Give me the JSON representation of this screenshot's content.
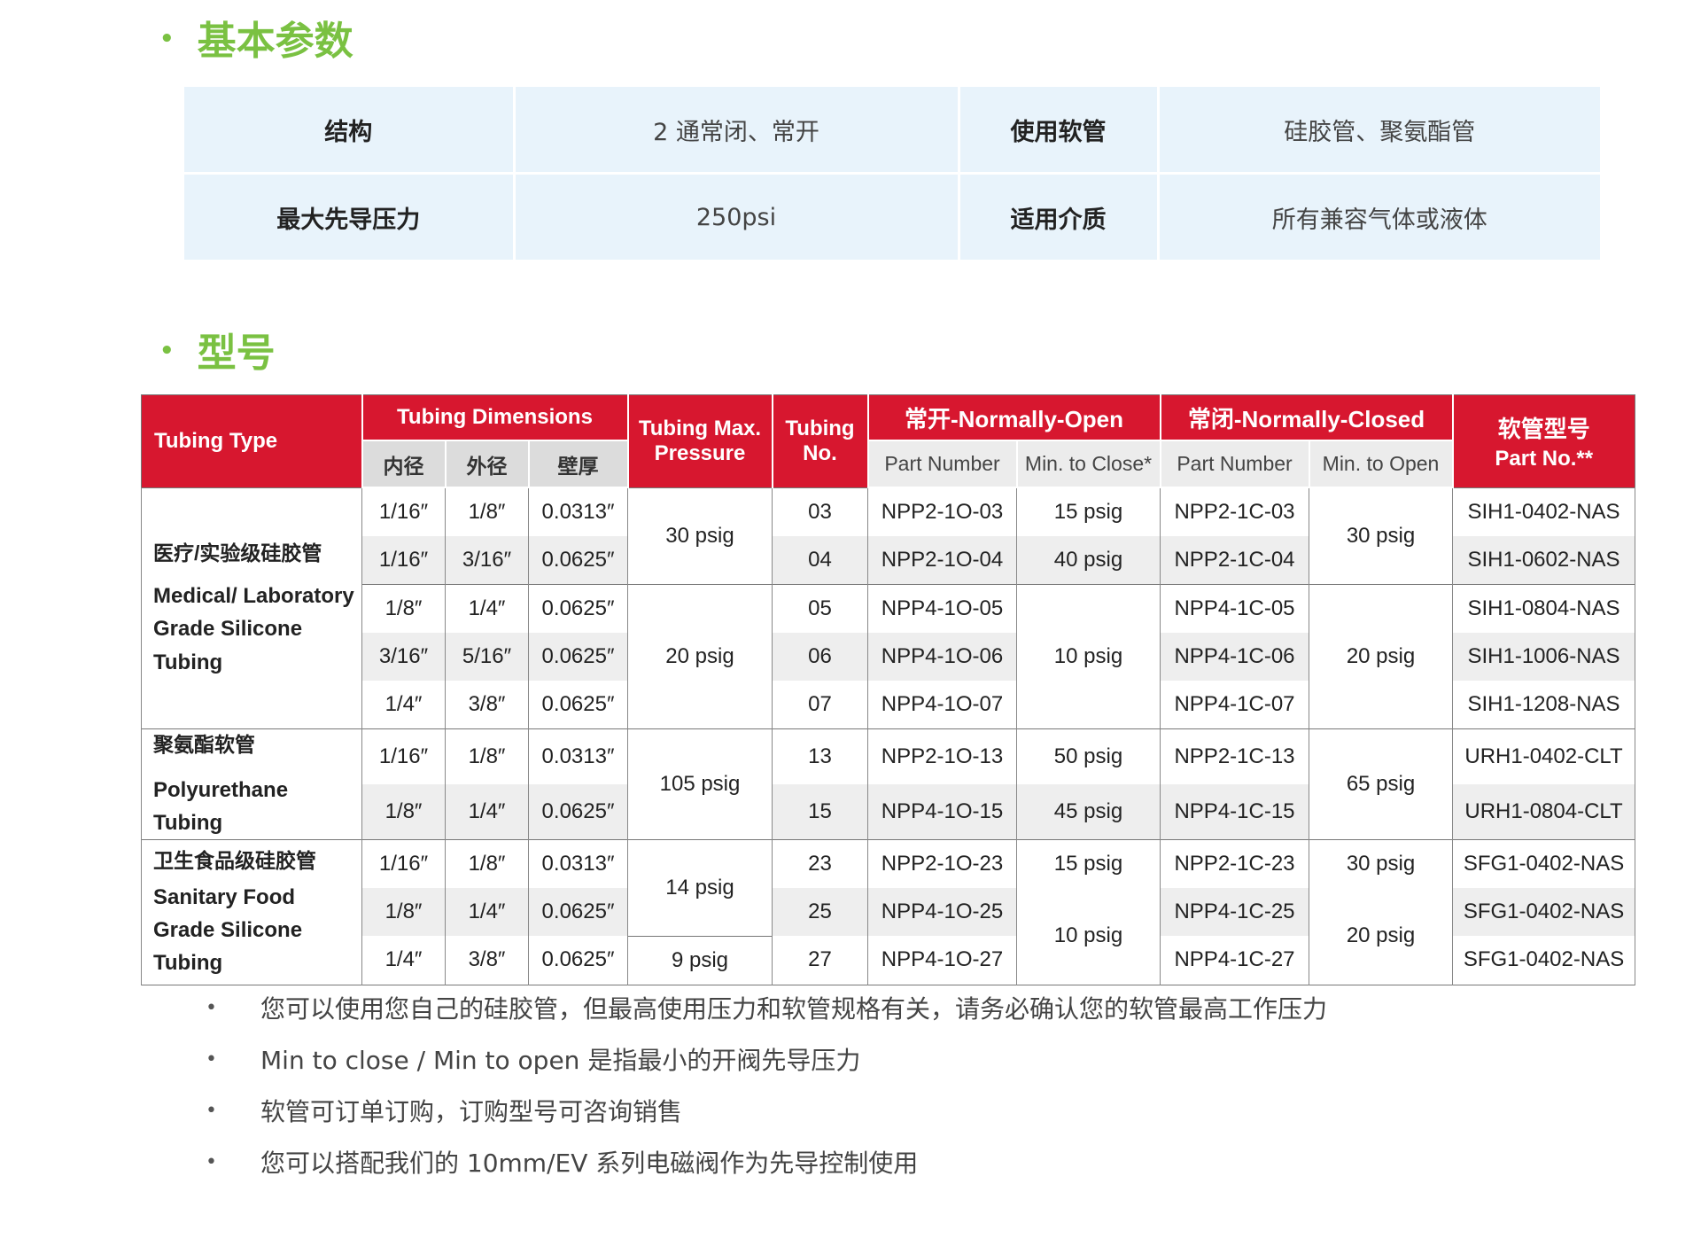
{
  "basic": {
    "title": "基本参数",
    "rows": [
      {
        "label1": "结构",
        "value1": "2 通常闭、常开",
        "label2": "使用软管",
        "value2": "硅胶管、聚氨酯管"
      },
      {
        "label1": "最大先导压力",
        "value1": "250psi",
        "label2": "适用介质",
        "value2": "所有兼容气体或液体"
      }
    ]
  },
  "models": {
    "title": "型号",
    "header": {
      "tubing_type": "Tubing Type",
      "tubing_dimensions": "Tubing Dimensions",
      "id": "内径",
      "od": "外径",
      "wall": "壁厚",
      "max_pressure_1": "Tubing Max.",
      "max_pressure_2": "Pressure",
      "tubing_no_1": "Tubing",
      "tubing_no_2": "No.",
      "normally_open": "常开-Normally-Open",
      "normally_closed": "常闭-Normally-Closed",
      "part_number": "Part Number",
      "min_to_close": "Min. to Close*",
      "min_to_open": "Min. to Open",
      "tube_model_1": "软管型号",
      "tube_model_2": "Part No.**"
    },
    "groups": [
      {
        "zh": "医疗/实验级硅胶管",
        "en": "Medical/ Laboratory Grade Silicone Tubing"
      },
      {
        "zh": "聚氨酯软管",
        "en": "Polyurethane Tubing"
      },
      {
        "zh": "卫生食品级硅胶管",
        "en": "Sanitary Food Grade Silicone Tubing"
      }
    ],
    "rows": [
      {
        "id": "1/16″",
        "od": "1/8″",
        "wall": "0.0313″",
        "no": "03",
        "no_part": "NPP2-1O-03",
        "nc_part": "NPP2-1C-03",
        "tube": "SIH1-0402-NAS"
      },
      {
        "id": "1/16″",
        "od": "3/16″",
        "wall": "0.0625″",
        "no": "04",
        "no_part": "NPP2-1O-04",
        "nc_part": "NPP2-1C-04",
        "tube": "SIH1-0602-NAS"
      },
      {
        "id": "1/8″",
        "od": "1/4″",
        "wall": "0.0625″",
        "no": "05",
        "no_part": "NPP4-1O-05",
        "nc_part": "NPP4-1C-05",
        "tube": "SIH1-0804-NAS"
      },
      {
        "id": "3/16″",
        "od": "5/16″",
        "wall": "0.0625″",
        "no": "06",
        "no_part": "NPP4-1O-06",
        "nc_part": "NPP4-1C-06",
        "tube": "SIH1-1006-NAS"
      },
      {
        "id": "1/4″",
        "od": "3/8″",
        "wall": "0.0625″",
        "no": "07",
        "no_part": "NPP4-1O-07",
        "nc_part": "NPP4-1C-07",
        "tube": "SIH1-1208-NAS"
      },
      {
        "id": "1/16″",
        "od": "1/8″",
        "wall": "0.0313″",
        "no": "13",
        "no_part": "NPP2-1O-13",
        "nc_part": "NPP2-1C-13",
        "tube": "URH1-0402-CLT"
      },
      {
        "id": "1/8″",
        "od": "1/4″",
        "wall": "0.0625″",
        "no": "15",
        "no_part": "NPP4-1O-15",
        "nc_part": "NPP4-1C-15",
        "tube": "URH1-0804-CLT"
      },
      {
        "id": "1/16″",
        "od": "1/8″",
        "wall": "0.0313″",
        "no": "23",
        "no_part": "NPP2-1O-23",
        "nc_part": "NPP2-1C-23",
        "tube": "SFG1-0402-NAS"
      },
      {
        "id": "1/8″",
        "od": "1/4″",
        "wall": "0.0625″",
        "no": "25",
        "no_part": "NPP4-1O-25",
        "nc_part": "NPP4-1C-25",
        "tube": "SFG1-0402-NAS"
      },
      {
        "id": "1/4″",
        "od": "3/8″",
        "wall": "0.0625″",
        "no": "27",
        "no_part": "NPP4-1O-27",
        "nc_part": "NPP4-1C-27",
        "tube": "SFG1-0402-NAS"
      }
    ],
    "max_pressure": [
      "30 psig",
      "20 psig",
      "105 psig",
      "14 psig",
      "9 psig"
    ],
    "min_close": [
      "15 psig",
      "40 psig",
      "10 psig",
      "50 psig",
      "45 psig",
      "15 psig",
      "10 psig"
    ],
    "min_open": [
      "30 psig",
      "20 psig",
      "65 psig",
      "30 psig",
      "20 psig"
    ]
  },
  "notes": [
    "您可以使用您自己的硅胶管，但最高使用压力和软管规格有关，请务必确认您的软管最高工作压力",
    "Min to close / Min to open 是指最小的开阀先导压力",
    "软管可订单订购，订购型号可咨询销售",
    "您可以搭配我们的 10mm/EV 系列电磁阀作为先导控制使用"
  ],
  "colors": {
    "accent_green": "#7ac142",
    "header_red": "#d7172f",
    "param_bg": "#e8f3fb"
  }
}
